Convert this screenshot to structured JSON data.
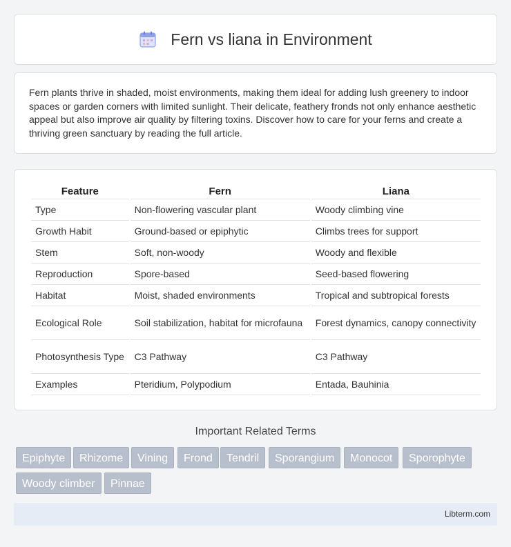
{
  "header": {
    "title": "Fern vs liana in Environment",
    "icon": "calendar-icon"
  },
  "intro": {
    "text": "Fern plants thrive in shaded, moist environments, making them ideal for adding lush greenery to indoor spaces or garden corners with limited sunlight. Their delicate, feathery fronds not only enhance aesthetic appeal but also improve air quality by filtering toxins. Discover how to care for your ferns and create a thriving green sanctuary by reading the full article."
  },
  "table": {
    "headers": [
      "Feature",
      "Fern",
      "Liana"
    ],
    "rows": [
      [
        "Type",
        "Non-flowering vascular plant",
        "Woody climbing vine"
      ],
      [
        "Growth Habit",
        "Ground-based or epiphytic",
        "Climbs trees for support"
      ],
      [
        "Stem",
        "Soft, non-woody",
        "Woody and flexible"
      ],
      [
        "Reproduction",
        "Spore-based",
        "Seed-based flowering"
      ],
      [
        "Habitat",
        "Moist, shaded environments",
        "Tropical and subtropical forests"
      ],
      [
        "Ecological Role",
        "Soil stabilization, habitat for microfauna",
        "Forest dynamics, canopy connectivity"
      ],
      [
        "Photosynthesis Type",
        "C3 Pathway",
        "C3 Pathway"
      ],
      [
        "Examples",
        "Pteridium, Polypodium",
        "Entada, Bauhinia"
      ]
    ]
  },
  "related": {
    "title": "Important Related Terms",
    "tags": [
      "Epiphyte",
      "Rhizome",
      "Vining",
      "Frond",
      "Tendril",
      "Sporangium",
      "Monocot",
      "Sporophyte",
      "Woody climber",
      "Pinnae"
    ]
  },
  "footer": {
    "text": "Libterm.com"
  },
  "colors": {
    "tag_bg": "#b8bfcc",
    "footer_bg": "#e6ecf6"
  }
}
